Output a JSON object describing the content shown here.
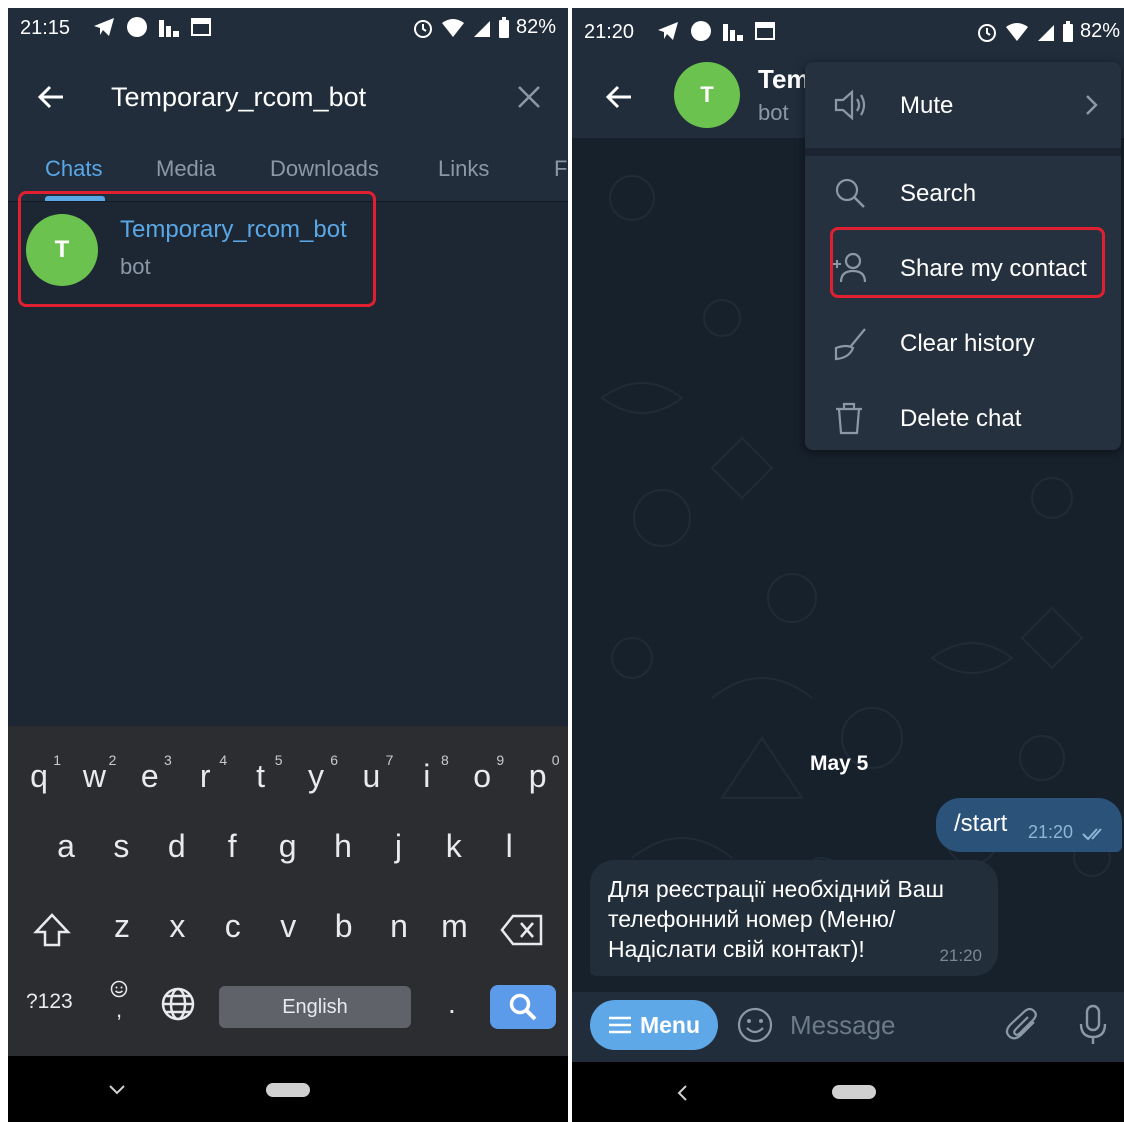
{
  "left": {
    "status": {
      "time": "21:15",
      "battery": "82%"
    },
    "header": {
      "title": "Temporary_rcom_bot"
    },
    "tabs": [
      "Chats",
      "Media",
      "Downloads",
      "Links",
      "F"
    ],
    "result": {
      "initial": "T",
      "name": "Temporary_rcom_bot",
      "subtitle": "bot"
    },
    "keyboard": {
      "row1": [
        {
          "letter": "q",
          "num": "1"
        },
        {
          "letter": "w",
          "num": "2"
        },
        {
          "letter": "e",
          "num": "3"
        },
        {
          "letter": "r",
          "num": "4"
        },
        {
          "letter": "t",
          "num": "5"
        },
        {
          "letter": "y",
          "num": "6"
        },
        {
          "letter": "u",
          "num": "7"
        },
        {
          "letter": "i",
          "num": "8"
        },
        {
          "letter": "o",
          "num": "9"
        },
        {
          "letter": "p",
          "num": "0"
        }
      ],
      "row2": [
        "a",
        "s",
        "d",
        "f",
        "g",
        "h",
        "j",
        "k",
        "l"
      ],
      "row3": [
        "z",
        "x",
        "c",
        "v",
        "b",
        "n",
        "m"
      ],
      "symbols_label": "?123",
      "space_label": "English",
      "period": ".",
      "comma": ","
    }
  },
  "right": {
    "status": {
      "time": "21:20",
      "battery": "82%"
    },
    "chat": {
      "initial": "T",
      "title": "Tem",
      "subtitle": "bot"
    },
    "menu": {
      "items": [
        {
          "label": "Mute",
          "icon": "speaker-icon"
        },
        {
          "label": "Search",
          "icon": "search-icon"
        },
        {
          "label": "Share my contact",
          "icon": "add-contact-icon"
        },
        {
          "label": "Clear history",
          "icon": "broom-icon"
        },
        {
          "label": "Delete chat",
          "icon": "trash-icon"
        }
      ]
    },
    "messages": {
      "date": "May 5",
      "outgoing": {
        "text": "/start",
        "time": "21:20"
      },
      "incoming": {
        "text": "Для реєстрації необхідний Ваш телефонний номер (Меню/Надіслати свій контакт)!",
        "time": "21:20"
      }
    },
    "input": {
      "menu_label": "Menu",
      "placeholder": "Message"
    }
  },
  "colors": {
    "accent": "#5aa7e6",
    "avatar": "#6cc24f",
    "highlight": "#e02031",
    "outgoing_bubble": "#2b5278"
  }
}
